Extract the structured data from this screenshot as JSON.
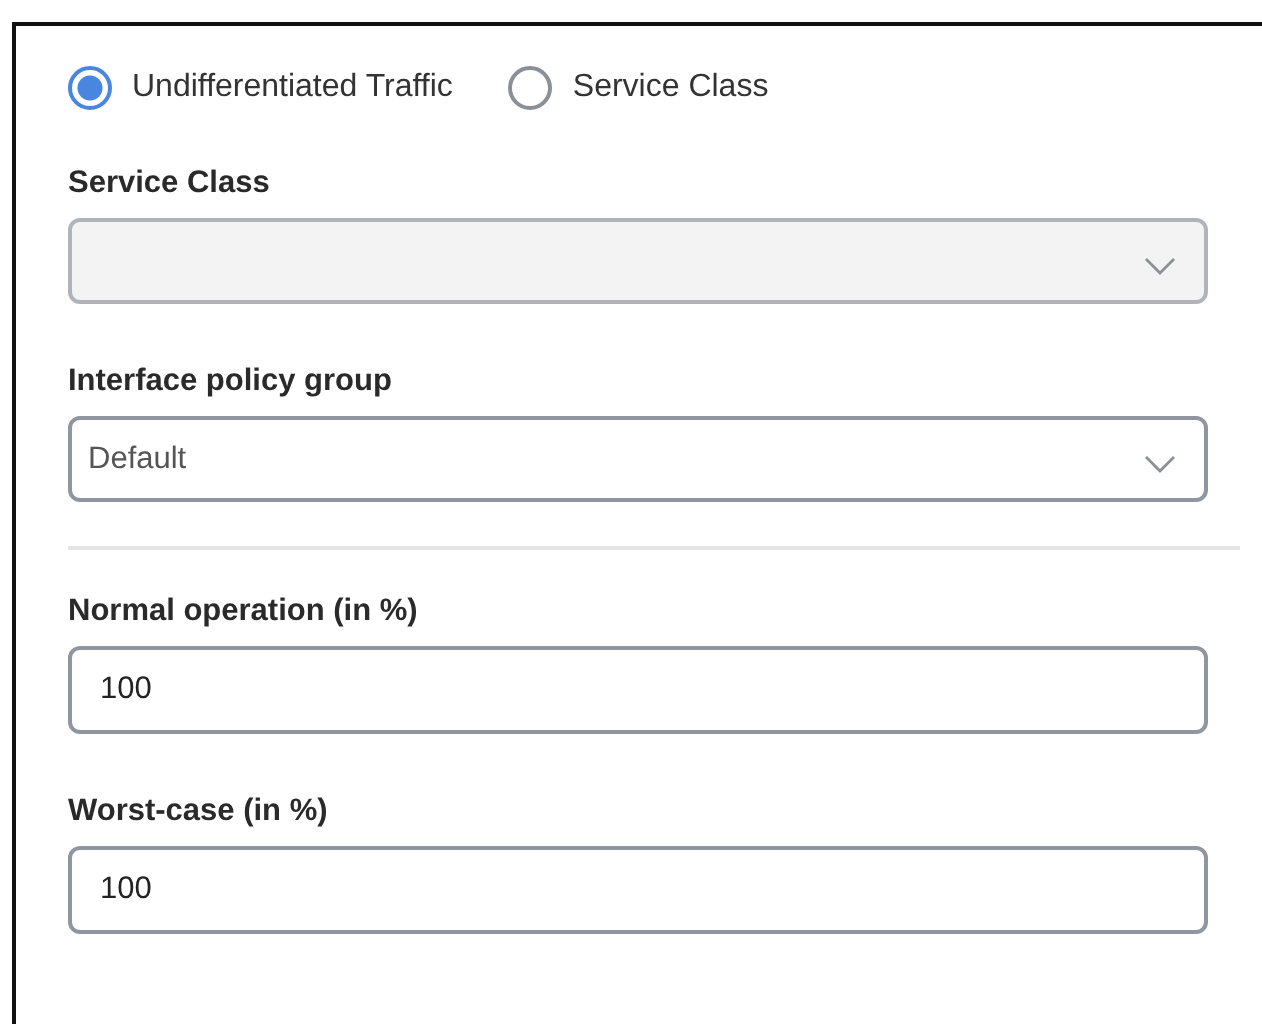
{
  "traffic_mode": [
    {
      "label": "Undifferentiated Traffic",
      "selected": true
    },
    {
      "label": "Service Class",
      "selected": false
    }
  ],
  "selects": [
    {
      "label": "Service Class",
      "disabled": true
    },
    {
      "label": "Interface policy group",
      "value": "Default",
      "disabled": false
    }
  ],
  "inputs": [
    {
      "label": "Normal operation (in %)",
      "value": "100"
    },
    {
      "label": "Worst-case (in %)",
      "value": "100"
    }
  ]
}
